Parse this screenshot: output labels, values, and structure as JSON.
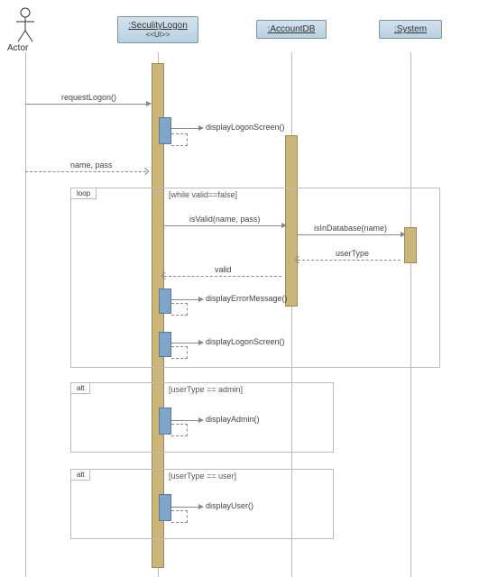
{
  "actor": {
    "label": "Actor"
  },
  "participants": {
    "p1": {
      "name": ":SeculityLogon",
      "stereo": "<<UI>>"
    },
    "p2": {
      "name": ":AccountDB"
    },
    "p3": {
      "name": ":System"
    }
  },
  "fragments": {
    "loop": {
      "tag": "loop",
      "guard": "[while valid==false]"
    },
    "alt1": {
      "tag": "alt",
      "guard": "[userType == admin]"
    },
    "alt2": {
      "tag": "alt",
      "guard": "[userType == user]"
    }
  },
  "messages": {
    "m1": "requestLogon()",
    "m2": "displayLogonScreen()",
    "m3": "name, pass",
    "m4": "isValid(name, pass)",
    "m5": "isInDatabase(name)",
    "m6": "userType",
    "m7": "valid",
    "m8": "displayErrorMessage()",
    "m9": "displayLogonScreen()",
    "m10": "displayAdmin()",
    "m11": "displayUser()"
  },
  "chart_data": {
    "type": "sequence_diagram",
    "participants": [
      {
        "id": "actor",
        "name": "Actor",
        "kind": "actor"
      },
      {
        "id": "p1",
        "name": ":SeculityLogon",
        "stereotype": "<<UI>>",
        "kind": "object"
      },
      {
        "id": "p2",
        "name": ":AccountDB",
        "kind": "object"
      },
      {
        "id": "p3",
        "name": ":System",
        "kind": "object"
      }
    ],
    "messages": [
      {
        "from": "actor",
        "to": "p1",
        "label": "requestLogon()",
        "type": "sync"
      },
      {
        "from": "p1",
        "to": "p1",
        "label": "displayLogonScreen()",
        "type": "self"
      },
      {
        "from": "actor",
        "to": "p1",
        "label": "name, pass",
        "type": "async"
      },
      {
        "fragment": "loop",
        "guard": "while valid==false",
        "messages": [
          {
            "from": "p1",
            "to": "p2",
            "label": "isValid(name, pass)",
            "type": "sync"
          },
          {
            "from": "p2",
            "to": "p3",
            "label": "isInDatabase(name)",
            "type": "sync"
          },
          {
            "from": "p3",
            "to": "p2",
            "label": "userType",
            "type": "return"
          },
          {
            "from": "p2",
            "to": "p1",
            "label": "valid",
            "type": "return"
          },
          {
            "from": "p1",
            "to": "p1",
            "label": "displayErrorMessage()",
            "type": "self"
          },
          {
            "from": "p1",
            "to": "p1",
            "label": "displayLogonScreen()",
            "type": "self"
          }
        ]
      },
      {
        "fragment": "alt",
        "guard": "userType == admin",
        "messages": [
          {
            "from": "p1",
            "to": "p1",
            "label": "displayAdmin()",
            "type": "self"
          }
        ]
      },
      {
        "fragment": "alt",
        "guard": "userType == user",
        "messages": [
          {
            "from": "p1",
            "to": "p1",
            "label": "displayUser()",
            "type": "self"
          }
        ]
      }
    ]
  }
}
